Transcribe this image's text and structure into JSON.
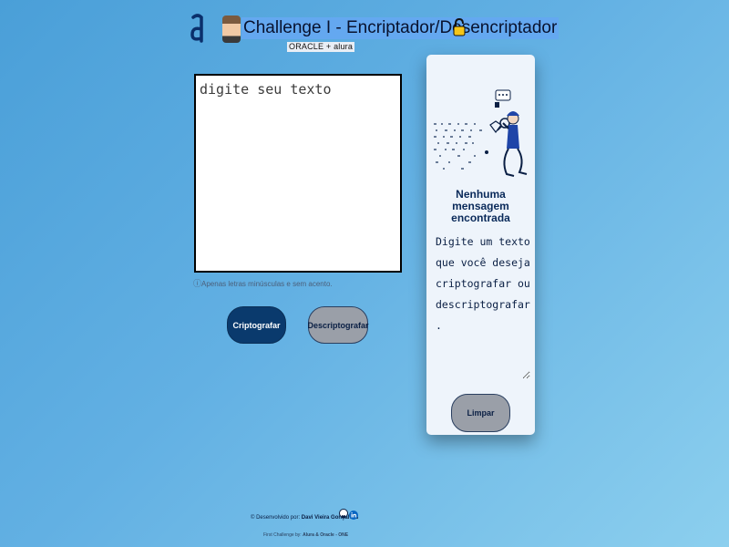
{
  "header": {
    "title": "Challenge I - Encriptador/Desencriptador",
    "partner_badge": "ORACLE + alura"
  },
  "input": {
    "placeholder": "digite seu texto",
    "hint_icon": "ⓘ",
    "hint": "Apenas letras minúsculas e sem acento."
  },
  "actions": {
    "encrypt_label": "Criptografar",
    "decrypt_label": "Descriptografar"
  },
  "output": {
    "title": "Nenhuma mensagem encontrada",
    "message": "Digite um texto que você deseja criptografar ou descriptografar.",
    "clear_label": "Limpar"
  },
  "footer": {
    "credit_prefix": "© Desenvolvido por:",
    "credit_name": "Davi Vieira Gonçalves",
    "line2_prefix": "First Challenge by:",
    "line2_name": "Alura & Oracle - ONE"
  },
  "colors": {
    "primary": "#0a3a6d",
    "secondary": "#9a9fa8",
    "title_highlight": "#64a8f0"
  },
  "icons": [
    "alura-logo-icon",
    "avatar",
    "lock-icon",
    "info-icon",
    "github-icon",
    "linkedin-icon",
    "detective-illustration"
  ]
}
